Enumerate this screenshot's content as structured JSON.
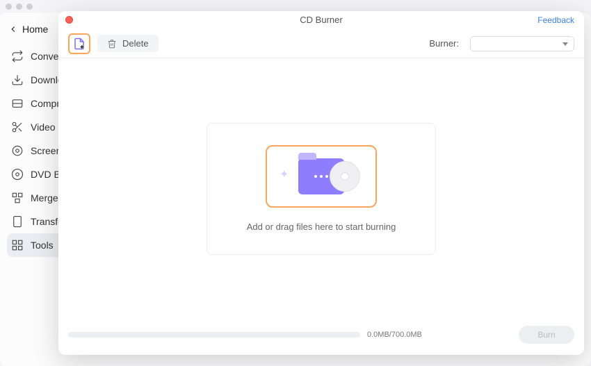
{
  "home_label": "Home",
  "sidebar": {
    "items": [
      {
        "label": "Converter"
      },
      {
        "label": "Downloader"
      },
      {
        "label": "Compressor"
      },
      {
        "label": "Video Editor"
      },
      {
        "label": "Screen Recorder"
      },
      {
        "label": "DVD Burner"
      },
      {
        "label": "Merger"
      },
      {
        "label": "Transfer"
      },
      {
        "label": "Tools"
      }
    ]
  },
  "modal": {
    "title": "CD Burner",
    "feedback": "Feedback",
    "delete_label": "Delete",
    "burner_label": "Burner:",
    "drop_hint": "Add or drag files here to start burning",
    "size_text": "0.0MB/700.0MB",
    "burn_label": "Burn"
  }
}
